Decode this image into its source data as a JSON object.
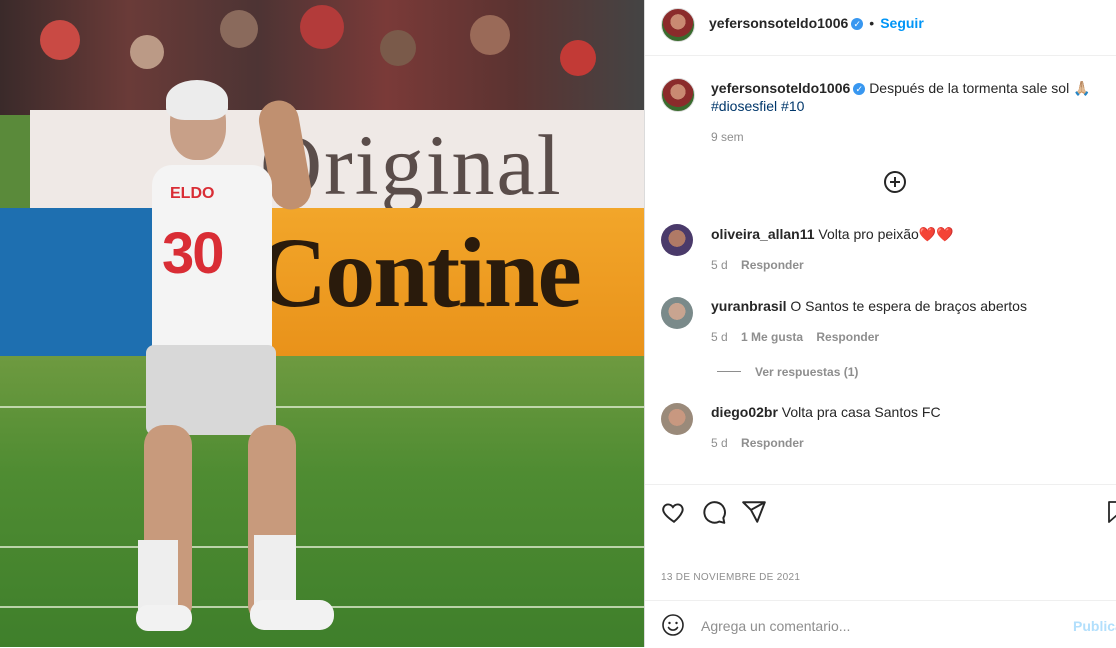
{
  "post": {
    "owner": "yefersonsoteldo1006",
    "follow_label": "Seguir",
    "caption_text": "Después de la tormenta sale sol 🙏🏼",
    "hashtags": "#diosesfiel #10",
    "caption_time": "9 sem",
    "date": "13 DE NOVIEMBRE DE 2021"
  },
  "comments": [
    {
      "user": "oliveira_allan11",
      "text": "Volta pro peixão❤️❤️",
      "time": "5 d",
      "reply": "Responder",
      "likes": ""
    },
    {
      "user": "yuranbrasil",
      "text": "O Santos te espera de braços abertos",
      "time": "5 d",
      "likes": "1 Me gusta",
      "reply": "Responder",
      "view_replies": "Ver respuestas (1)"
    },
    {
      "user": "diego02br",
      "text": "Volta pra casa Santos FC",
      "time": "5 d",
      "reply": "Responder",
      "likes": ""
    }
  ],
  "composer": {
    "placeholder": "Agrega un comentario...",
    "publish": "Publica"
  },
  "icons": [
    "heart-icon",
    "comment-icon",
    "share-icon",
    "bookmark-icon",
    "emoji-icon",
    "add-circle-icon",
    "verified-icon"
  ],
  "colors": {
    "link": "#0095f6",
    "verified": "#3897f0",
    "muted": "#8e8e8e",
    "hashtag": "#00376b"
  },
  "photo": {
    "banner_text": "Original",
    "board_text": "Contine",
    "jersey_number": "30",
    "jersey_name": "ELDO"
  }
}
